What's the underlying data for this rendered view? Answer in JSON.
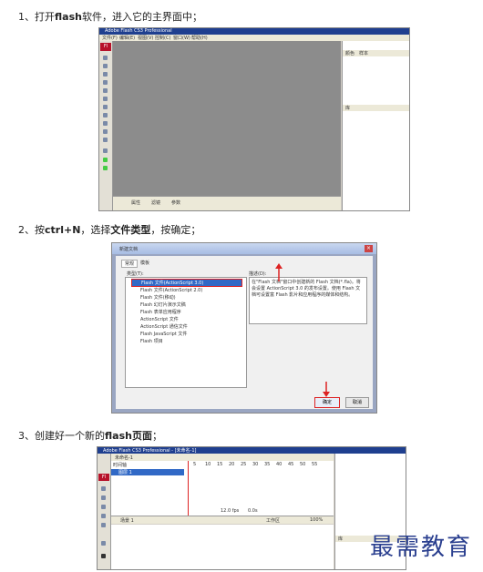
{
  "steps": [
    {
      "prefix": "1、打开",
      "bold": "flash",
      "suffix": "软件，进入它的主界面中；"
    },
    {
      "prefix": "2、按",
      "bold": "ctrl+N",
      "mid": "，选择",
      "bold2": "文件类型",
      "suffix": "，按确定；"
    },
    {
      "prefix": "3、创建好一个新的",
      "bold": "flash页面",
      "suffix": "；"
    }
  ],
  "shot1": {
    "title": "Adobe Flash CS3 Professional",
    "menu": [
      "文件(F)",
      "编辑(E)",
      "视图(V)",
      "控制(C)",
      "窗口(W)",
      "帮助(H)"
    ],
    "panel_tabs": [
      "颜色",
      "样本"
    ],
    "panel_label": "库",
    "logo": "Fl",
    "bottom_tabs": [
      "属性",
      "滤镜",
      "参数"
    ]
  },
  "shot2": {
    "title": "新建文档",
    "tabs": [
      "常规",
      "模板"
    ],
    "type_label": "类型(T):",
    "desc_label": "描述(D):",
    "items": [
      "Flash 文件(ActionScript 3.0)",
      "Flash 文件(ActionScript 2.0)",
      "Flash 文件(移动)",
      "Flash 幻灯片演示文稿",
      "Flash 表单应用程序",
      "ActionScript 文件",
      "ActionScript 通信文件",
      "Flash JavaScript 文件",
      "Flash 项目"
    ],
    "description": "在\"Flash 文档\"窗口中创建新的 Flash 文档(*.fla)。将会设置 ActionScript 3.0 的发布设置。使用 Flash 文档可设置富 Flash 影片和应用程序的媒体和结构。",
    "ok": "确定",
    "cancel": "取消"
  },
  "shot3": {
    "title": "Adobe Flash CS3 Professional - [未命名-1]",
    "doc_tab": "未命名-1",
    "timeline_label": "时间轴",
    "layer": "图层 1",
    "frame_numbers": [
      "5",
      "10",
      "15",
      "20",
      "25",
      "30",
      "35",
      "40",
      "45",
      "50",
      "55"
    ],
    "fps": "12.0 fps",
    "time": "0.0s",
    "scene": "场景 1",
    "workspace": "工作区",
    "zoom": "100%",
    "panel_label": "库",
    "logo": "Fl"
  },
  "watermark": "最需教育"
}
